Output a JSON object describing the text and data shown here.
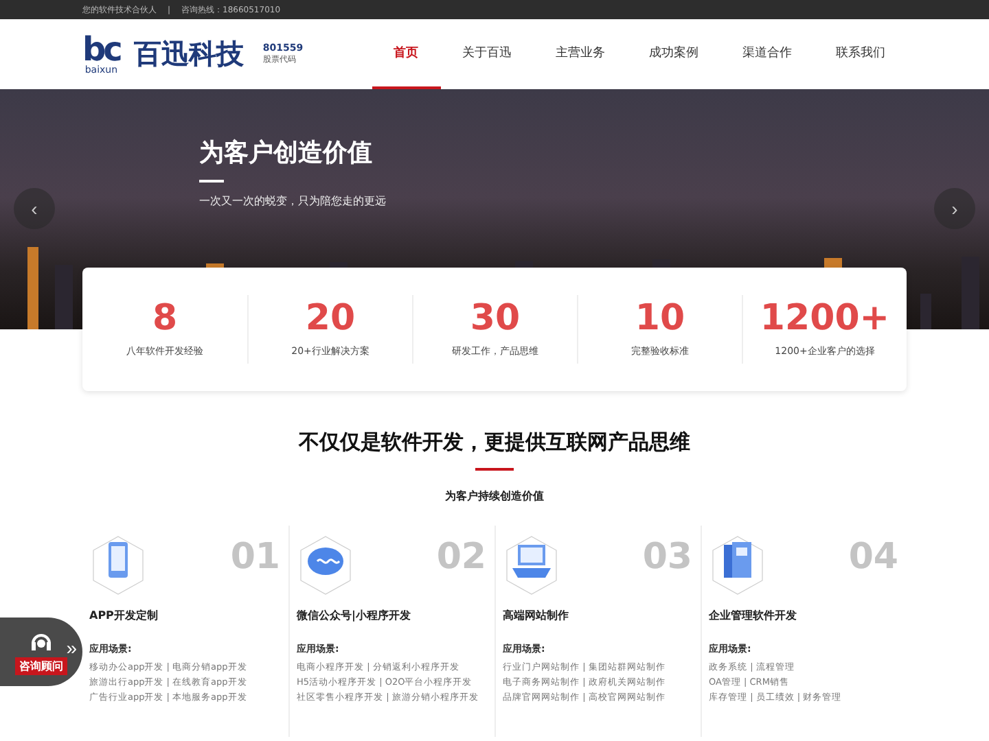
{
  "top_bar": {
    "tagline": "您的软件技术合伙人",
    "separator": "|",
    "hotline": "咨询热线：18660517010"
  },
  "header": {
    "logo_mark": "bc",
    "logo_sub": "baixun",
    "brand": "百迅科技",
    "stock_code": "801559",
    "stock_label": "股票代码",
    "nav": [
      {
        "label": "首页",
        "selected": true
      },
      {
        "label": "关于百迅",
        "selected": false
      },
      {
        "label": "主营业务",
        "selected": false
      },
      {
        "label": "成功案例",
        "selected": false
      },
      {
        "label": "渠道合作",
        "selected": false
      },
      {
        "label": "联系我们",
        "selected": false
      }
    ]
  },
  "hero": {
    "title": "为客户创造价值",
    "subtitle": "一次又一次的蜕变，只为陪您走的更远",
    "prev": "‹",
    "next": "›"
  },
  "stats": [
    {
      "value": "8",
      "label": "八年软件开发经验"
    },
    {
      "value": "20",
      "label": "20+行业解决方案"
    },
    {
      "value": "30",
      "label": "研发工作，产品思维"
    },
    {
      "value": "10",
      "label": "完整验收标准"
    },
    {
      "value": "1200+",
      "label": "1200+企业客户的选择"
    }
  ],
  "section": {
    "title": "不仅仅是软件开发，更提供互联网产品思维",
    "subtitle": "为客户持续创造价值"
  },
  "services": [
    {
      "kind": "phone",
      "number": "01",
      "title": "APP开发定制",
      "scene_label": "应用场景:",
      "lines": [
        "移动办公app开发 | 电商分销app开发",
        "旅游出行app开发 | 在线教育app开发",
        "广告行业app开发 | 本地服务app开发"
      ]
    },
    {
      "kind": "chat",
      "number": "02",
      "title": "微信公众号|小程序开发",
      "scene_label": "应用场景:",
      "lines": [
        "电商小程序开发 | 分销返利小程序开发",
        "H5活动小程序开发 | O2O平台小程序开发",
        "社区零售小程序开发 | 旅游分销小程序开发"
      ]
    },
    {
      "kind": "laptop",
      "number": "03",
      "title": "高端网站制作",
      "scene_label": "应用场景:",
      "lines": [
        "行业门户网站制作 | 集团站群网站制作",
        "电子商务网站制作 | 政府机关网站制作",
        "品牌官网网站制作 | 高校官网网站制作"
      ]
    },
    {
      "kind": "books",
      "number": "04",
      "title": "企业管理软件开发",
      "scene_label": "应用场景:",
      "lines": [
        "政务系统 | 流程管理",
        "OA管理 | CRM销售",
        "库存管理 | 员工绩效 | 财务管理"
      ]
    }
  ],
  "consult": {
    "label": "咨询顾问",
    "expand": "»"
  }
}
